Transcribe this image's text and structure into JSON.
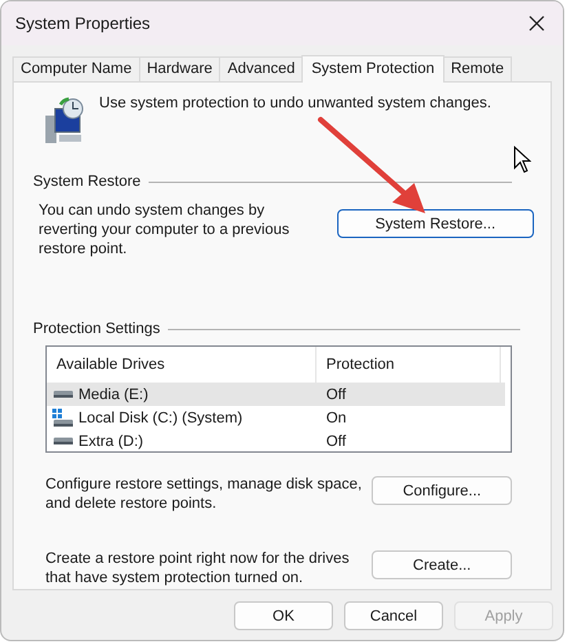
{
  "window": {
    "title": "System Properties"
  },
  "tabs": [
    {
      "label": "Computer Name",
      "selected": false
    },
    {
      "label": "Hardware",
      "selected": false
    },
    {
      "label": "Advanced",
      "selected": false
    },
    {
      "label": "System Protection",
      "selected": true
    },
    {
      "label": "Remote",
      "selected": false
    }
  ],
  "intro": "Use system protection to undo unwanted system changes.",
  "system_restore": {
    "heading": "System Restore",
    "description": "You can undo system changes by reverting your computer to a previous restore point.",
    "button": "System Restore..."
  },
  "protection_settings": {
    "heading": "Protection Settings",
    "columns": [
      "Available Drives",
      "Protection"
    ],
    "rows": [
      {
        "drive": "Media (E:)",
        "protection": "Off",
        "kind": "drive",
        "selected": true
      },
      {
        "drive": "Local Disk (C:) (System)",
        "protection": "On",
        "kind": "system",
        "selected": false
      },
      {
        "drive": "Extra (D:)",
        "protection": "Off",
        "kind": "drive",
        "selected": false
      }
    ],
    "actions": [
      {
        "text": "Configure restore settings, manage disk space, and delete restore points.",
        "button": "Configure..."
      },
      {
        "text": "Create a restore point right now for the drives that have system protection turned on.",
        "button": "Create..."
      }
    ]
  },
  "buttons": [
    {
      "label": "OK",
      "disabled": false
    },
    {
      "label": "Cancel",
      "disabled": false
    },
    {
      "label": "Apply",
      "disabled": true
    }
  ]
}
